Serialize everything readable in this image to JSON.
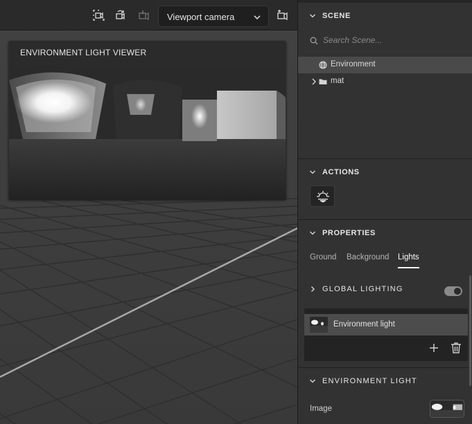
{
  "toolbar": {
    "camera_select_value": "Viewport camera",
    "icons": [
      "frame-camera-icon",
      "reset-camera-icon",
      "save-camera-icon",
      "add-camera-icon"
    ]
  },
  "viewer": {
    "title": "ENVIRONMENT LIGHT VIEWER"
  },
  "scene": {
    "title": "SCENE",
    "search_placeholder": "Search Scene...",
    "items": [
      {
        "label": "Environment",
        "icon": "globe-icon",
        "selected": true
      },
      {
        "label": "mat",
        "icon": "folder-icon",
        "selected": false
      }
    ]
  },
  "actions": {
    "title": "ACTIONS",
    "button_icon": "sun-horizon-icon"
  },
  "properties": {
    "title": "PROPERTIES",
    "tabs": [
      {
        "label": "Ground",
        "active": false
      },
      {
        "label": "Background",
        "active": false
      },
      {
        "label": "Lights",
        "active": true
      }
    ],
    "global_lighting_label": "GLOBAL LIGHTING",
    "global_lighting_on": true,
    "lights": [
      {
        "label": "Environment light"
      }
    ]
  },
  "environment_light": {
    "title": "ENVIRONMENT LIGHT",
    "image_label": "Image"
  },
  "colors": {
    "panel_bg": "#323232",
    "selected_row": "#4a4a4a",
    "viewport_floor": "#3c3c3c",
    "grid_line": "#2c2c2c",
    "axis_line": "#9a9a9a"
  }
}
